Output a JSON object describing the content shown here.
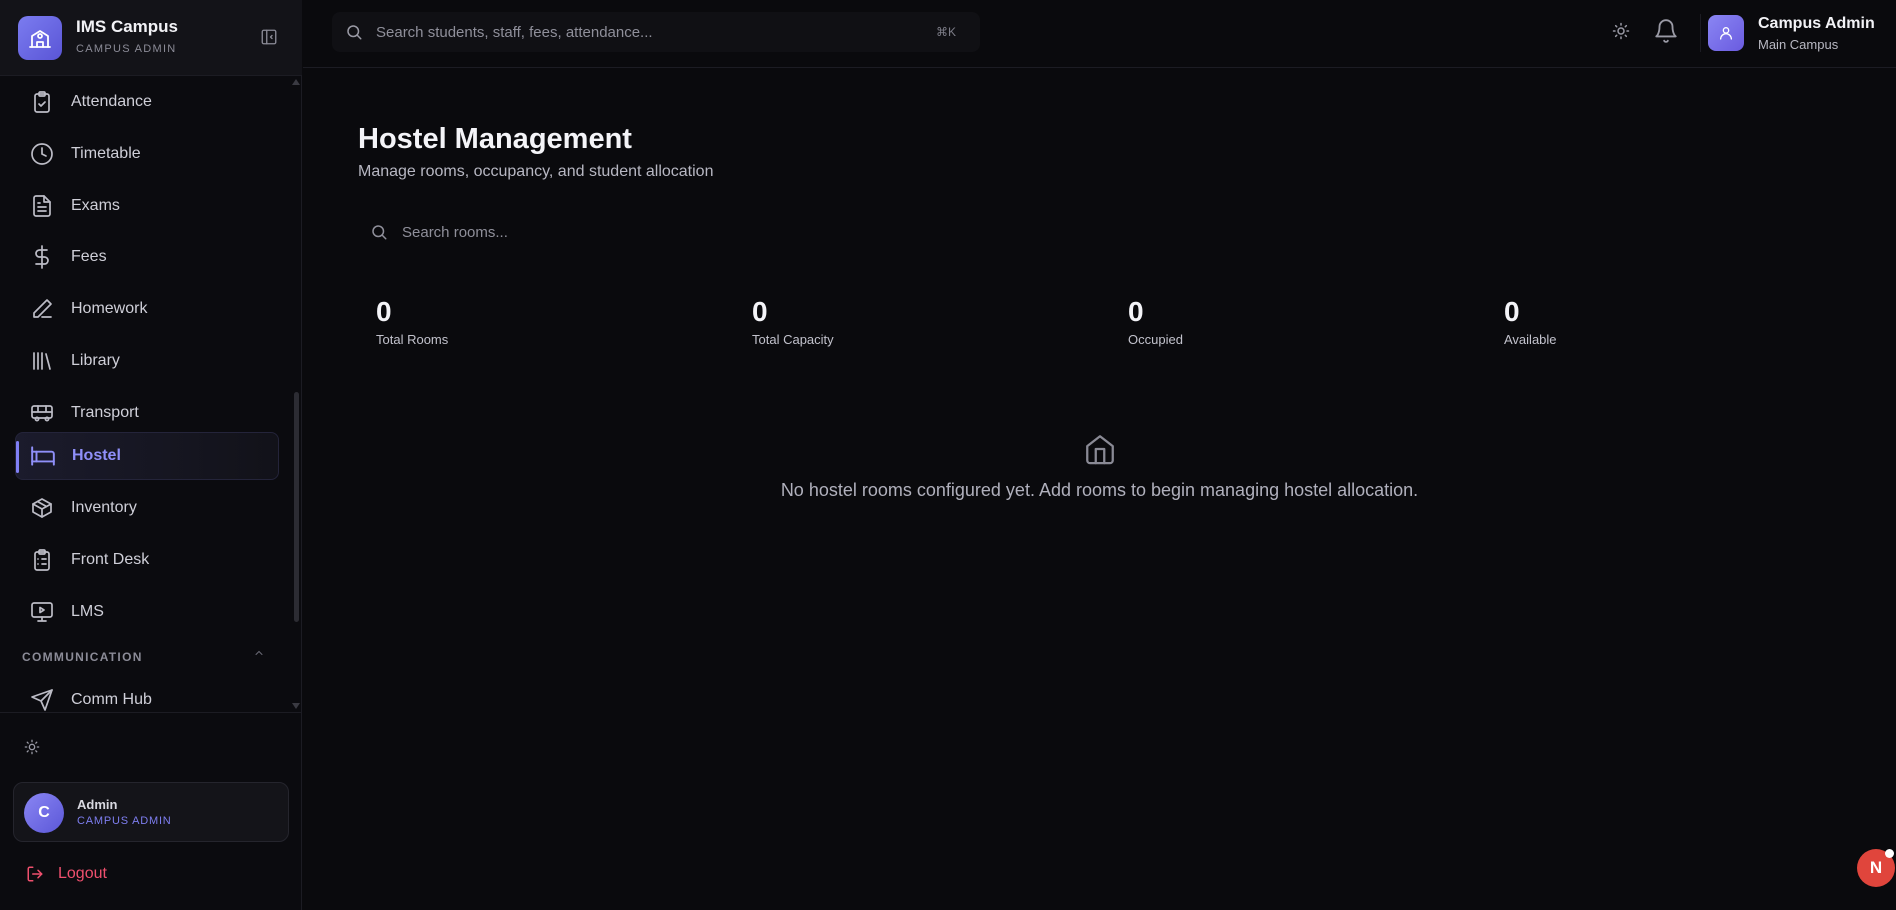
{
  "brand": {
    "title": "IMS Campus",
    "subtitle": "CAMPUS ADMIN"
  },
  "sidebar": {
    "items": [
      {
        "label": "Attendance",
        "icon": "clipboard-check-icon"
      },
      {
        "label": "Timetable",
        "icon": "clock-icon"
      },
      {
        "label": "Exams",
        "icon": "file-text-icon"
      },
      {
        "label": "Fees",
        "icon": "dollar-icon"
      },
      {
        "label": "Homework",
        "icon": "pen-icon"
      },
      {
        "label": "Library",
        "icon": "library-icon"
      },
      {
        "label": "Transport",
        "icon": "bus-icon"
      },
      {
        "label": "Hostel",
        "icon": "bed-icon",
        "active": true
      },
      {
        "label": "Inventory",
        "icon": "package-icon"
      },
      {
        "label": "Front Desk",
        "icon": "clipboard-list-icon"
      },
      {
        "label": "LMS",
        "icon": "monitor-play-icon"
      }
    ],
    "section": "COMMUNICATION",
    "section_items": [
      {
        "label": "Comm Hub",
        "icon": "send-icon"
      }
    ],
    "user": {
      "initial": "C",
      "name": "Admin",
      "role": "CAMPUS ADMIN"
    },
    "logout": "Logout"
  },
  "topbar": {
    "search_placeholder": "Search students, staff, fees, attendance...",
    "shortcut": "⌘K",
    "user_name": "Campus Admin",
    "user_sub": "Main Campus"
  },
  "main": {
    "title": "Hostel Management",
    "subtitle": "Manage rooms, occupancy, and student allocation",
    "search_placeholder": "Search rooms...",
    "stats": [
      {
        "value": "0",
        "label": "Total Rooms"
      },
      {
        "value": "0",
        "label": "Total Capacity"
      },
      {
        "value": "0",
        "label": "Occupied"
      },
      {
        "value": "0",
        "label": "Available"
      }
    ],
    "empty_message": "No hostel rooms configured yet. Add rooms to begin managing hostel allocation."
  },
  "fab": {
    "label": "N"
  },
  "colors": {
    "accent": "#7f7ff5",
    "danger": "#f0506e",
    "background": "#0a0a0d"
  }
}
